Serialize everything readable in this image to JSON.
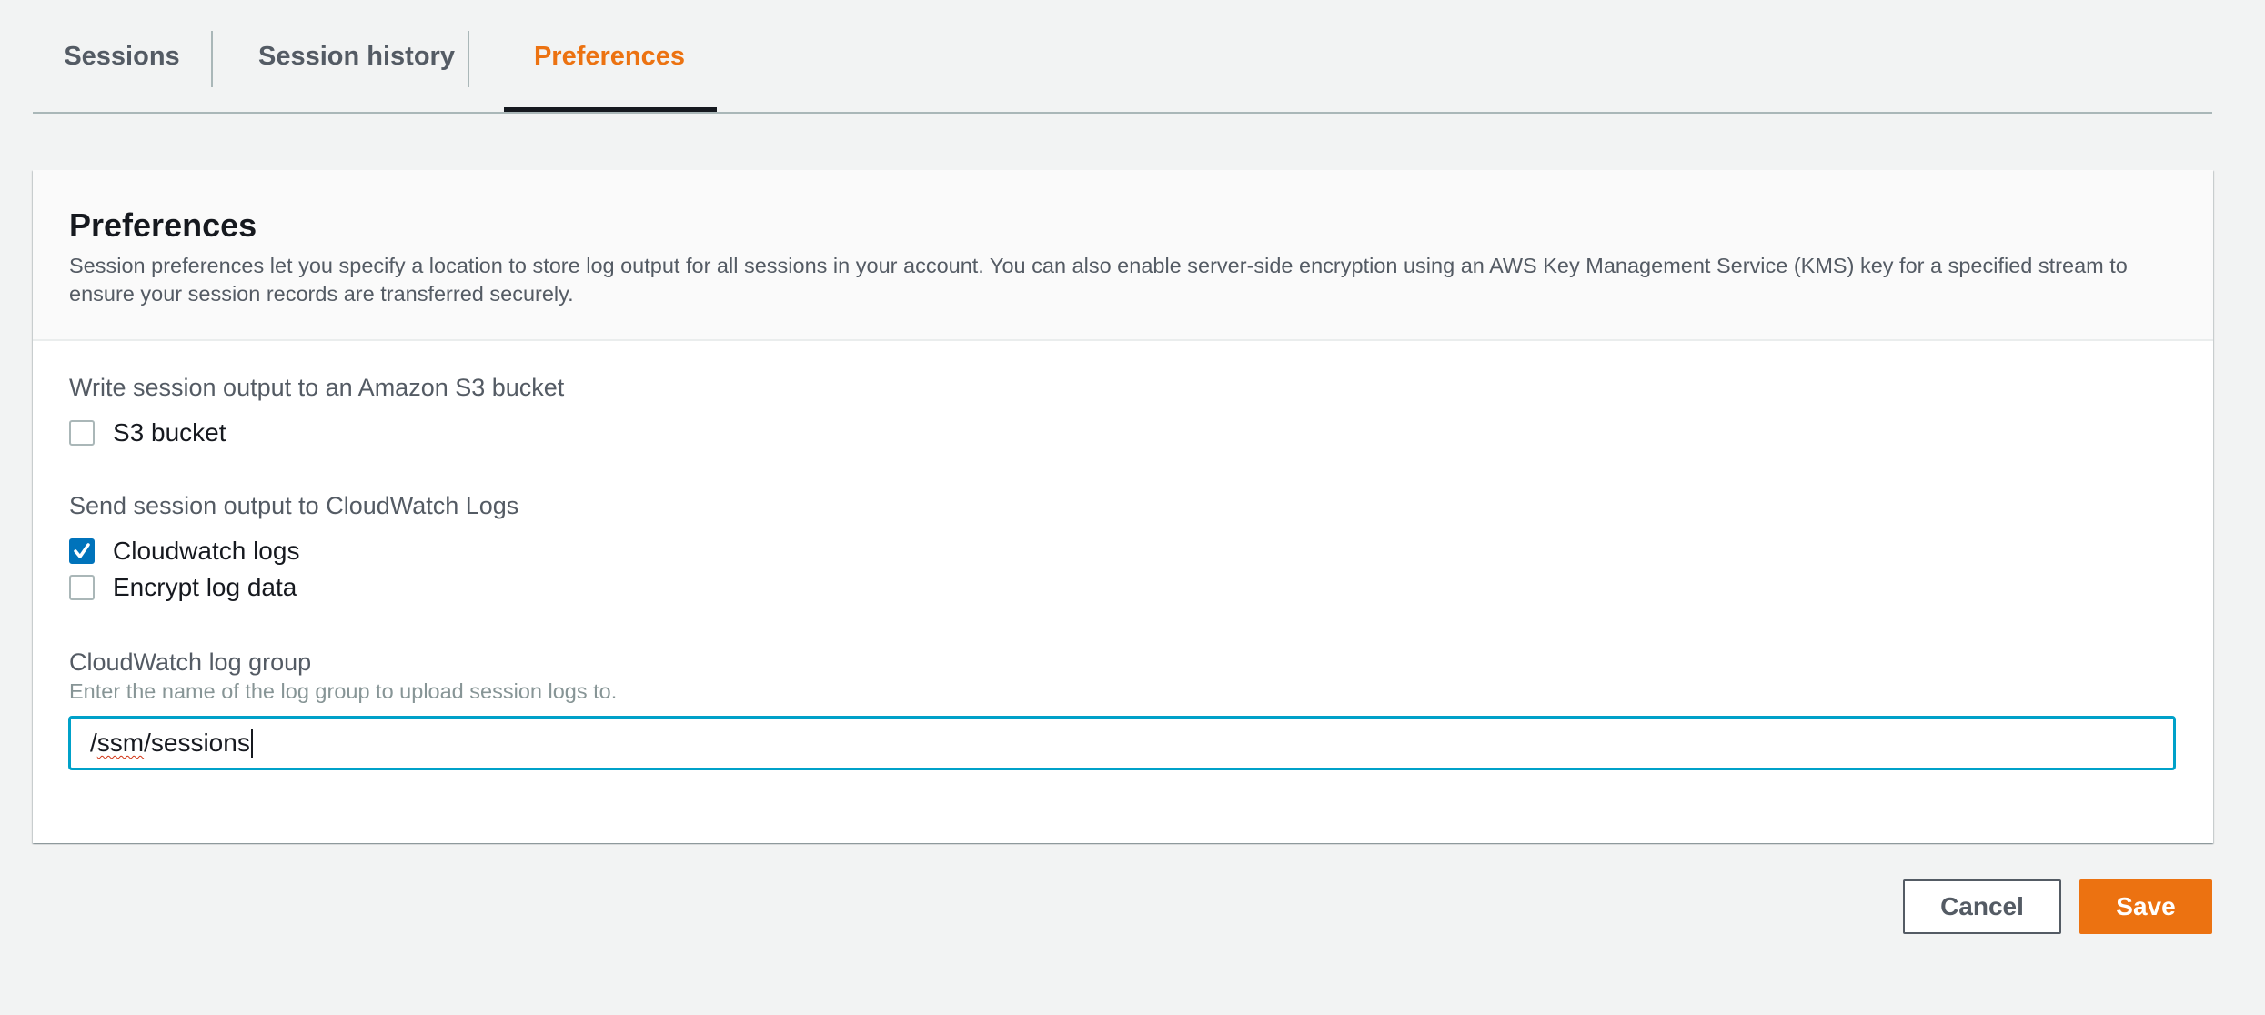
{
  "tabs": {
    "items": [
      {
        "label": "Sessions",
        "active": false
      },
      {
        "label": "Session history",
        "active": false
      },
      {
        "label": "Preferences",
        "active": true
      }
    ]
  },
  "panel": {
    "title": "Preferences",
    "description": "Session preferences let you specify a location to store log output for all sessions in your account. You can also enable server-side encryption using an AWS Key Management Service (KMS) key for a specified stream to ensure your session records are transferred securely."
  },
  "s3": {
    "section_label": "Write session output to an Amazon S3 bucket",
    "checkbox_label": "S3 bucket",
    "checked": false
  },
  "cloudwatch": {
    "section_label": "Send session output to CloudWatch Logs",
    "logs_label": "Cloudwatch logs",
    "logs_checked": true,
    "encrypt_label": "Encrypt log data",
    "encrypt_checked": false
  },
  "log_group": {
    "label": "CloudWatch log group",
    "hint": "Enter the name of the log group to upload session logs to.",
    "value_prefix": "/",
    "value_misspelled": "ssm",
    "value_suffix": "/sessions"
  },
  "actions": {
    "cancel_label": "Cancel",
    "save_label": "Save"
  },
  "colors": {
    "accent": "#ec7211",
    "checkbox_checked": "#0073bb",
    "input_focus": "#00a1c9"
  }
}
